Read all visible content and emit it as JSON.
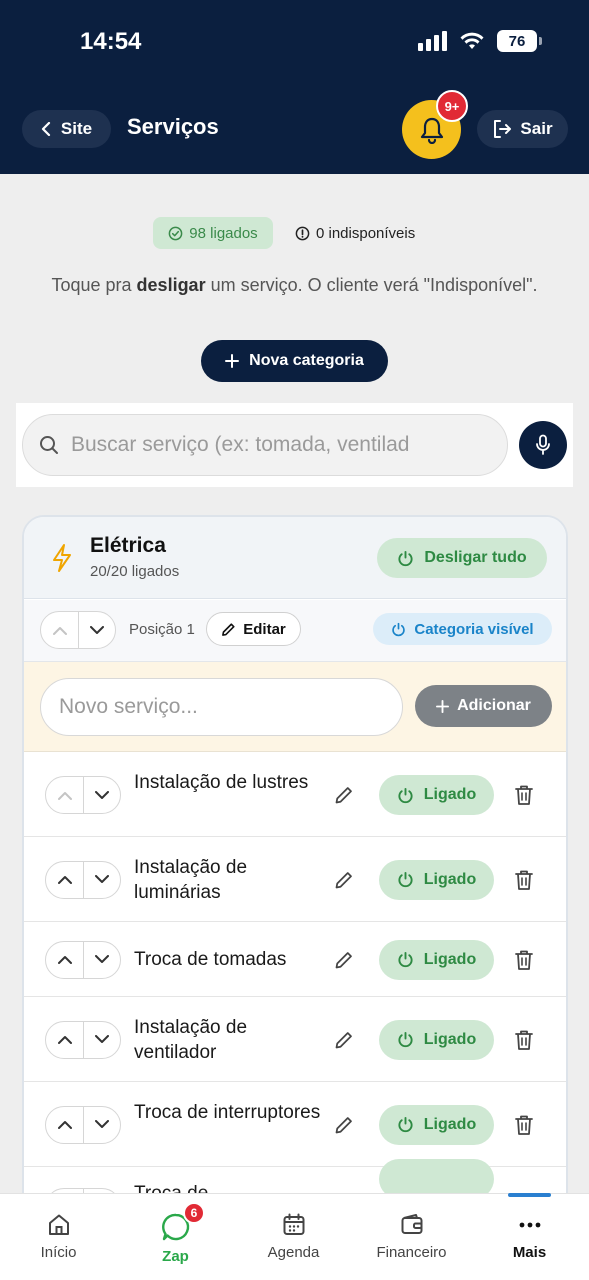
{
  "status": {
    "time": "14:54",
    "battery": "76"
  },
  "header": {
    "back_label": "Site",
    "title": "Serviços",
    "notif_badge": "9+",
    "logout_label": "Sair"
  },
  "summary": {
    "on_label": "98 ligados",
    "off_label": "0 indisponíveis",
    "hint_pre": "Toque pra ",
    "hint_bold": "desligar",
    "hint_post": " um serviço. O cliente verá \"Indisponível\".",
    "new_category_label": "Nova categoria"
  },
  "search": {
    "placeholder": "Buscar serviço (ex: tomada, ventilad"
  },
  "category": {
    "icon": "lightning-icon",
    "title": "Elétrica",
    "count": "20/20 ligados",
    "off_all_label": "Desligar tudo",
    "position_label": "Posição 1",
    "edit_label": "Editar",
    "visible_label": "Categoria visível",
    "new_service_placeholder": "Novo serviço...",
    "add_label": "Adicionar",
    "services": [
      {
        "name": "Instalação de lustres",
        "status": "Ligado"
      },
      {
        "name": "Instalação de luminárias",
        "status": "Ligado"
      },
      {
        "name": "Troca de tomadas",
        "status": "Ligado"
      },
      {
        "name": "Instalação de ventilador",
        "status": "Ligado"
      },
      {
        "name": "Troca de interruptores",
        "status": "Ligado"
      },
      {
        "name": "Troca de",
        "status": ""
      }
    ]
  },
  "nav": {
    "items": [
      {
        "label": "Início",
        "icon": "home-icon"
      },
      {
        "label": "Zap",
        "icon": "whatsapp-icon",
        "badge": "6"
      },
      {
        "label": "Agenda",
        "icon": "calendar-icon"
      },
      {
        "label": "Financeiro",
        "icon": "wallet-icon"
      },
      {
        "label": "Mais",
        "icon": "more-dots-icon"
      }
    ]
  },
  "colors": {
    "navy": "#0b1f3f",
    "bell": "#f4c01d",
    "badge": "#e12a35",
    "on_green": "#2e8a43",
    "on_green_bg": "#cfe8d3",
    "visible_blue": "#1a84c9"
  }
}
